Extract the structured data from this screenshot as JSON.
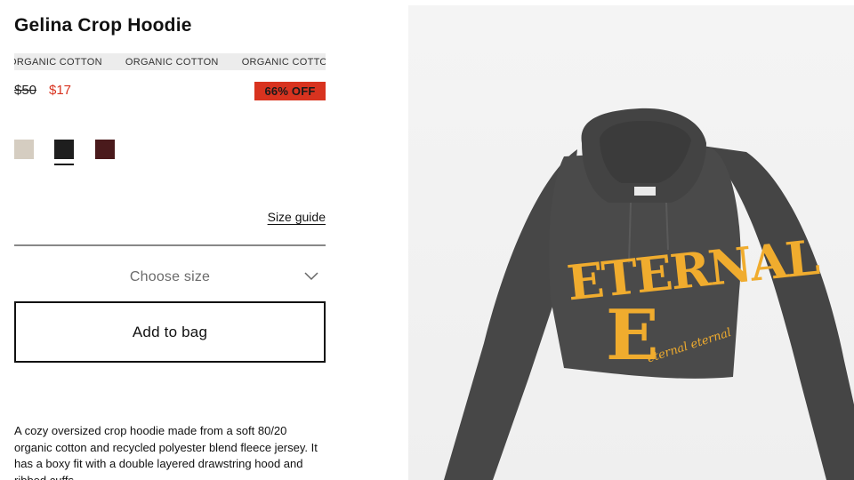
{
  "product": {
    "title": "Gelina Crop Hoodie",
    "material_banner": [
      "ORGANIC COTTON",
      "ORGANIC COTTON",
      "ORGANIC COTTON"
    ],
    "price_original": "$50",
    "price_sale": "$17",
    "discount_badge": "66% OFF",
    "colors": [
      {
        "name": "beige",
        "hex": "#d5cdc1"
      },
      {
        "name": "black",
        "hex": "#1e1e1e",
        "selected": true
      },
      {
        "name": "burgundy",
        "hex": "#4a1a1c"
      }
    ],
    "size_guide_label": "Size guide",
    "size_select_label": "Choose size",
    "add_to_bag_label": "Add to bag",
    "description": "A cozy oversized crop hoodie made from a soft 80/20 organic cotton and recycled polyester blend fleece jersey. It has a boxy fit with a double layered drawstring hood and ribbed cuffs."
  },
  "image": {
    "graphic_text": "ETERNAL",
    "graphic_letter": "E",
    "graphic_script": "eternal eternal",
    "hoodie_color": "#474747",
    "print_color": "#f0ac2e"
  },
  "colors": {
    "accent_red": "#d8331f",
    "text": "#111111",
    "muted": "#6b6b6b"
  }
}
